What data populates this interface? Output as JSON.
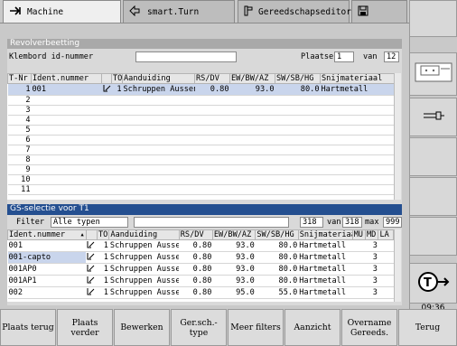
{
  "tabs": [
    {
      "label": "Machine",
      "icon": "machine-arrow-icon"
    },
    {
      "label": "smart.Turn",
      "icon": "smart-turn-arrows-icon"
    },
    {
      "label": "Gereedschapseditor",
      "icon": "tool-editor-icon"
    },
    {
      "label": "",
      "icon": "save-disk-icon"
    }
  ],
  "revolver": {
    "title": "Revolverbeetting",
    "clipboard_label": "Klembord id-nummer",
    "clipboard_value": "",
    "places_label": "Plaatsen",
    "place_current": "1",
    "place_of": "van",
    "place_total": "12",
    "columns": [
      "T-Nr",
      "Ident.nummer",
      "TO",
      "Aanduiding",
      "RS/DV",
      "EW/BW/AZ",
      "SW/SB/HG",
      "Snijmateriaal"
    ],
    "rows": [
      {
        "tnr": "1",
        "ident": "001",
        "to": "1",
        "name": "Schruppen Aussen",
        "rs": "0.80",
        "ew": "93.0",
        "sw": "80.0",
        "mat": "Hartmetall"
      },
      {
        "tnr": "2"
      },
      {
        "tnr": "3"
      },
      {
        "tnr": "4"
      },
      {
        "tnr": "5"
      },
      {
        "tnr": "6"
      },
      {
        "tnr": "7"
      },
      {
        "tnr": "8"
      },
      {
        "tnr": "9"
      },
      {
        "tnr": "10"
      },
      {
        "tnr": "11"
      }
    ]
  },
  "selection": {
    "title": "GS-selectie voor T1",
    "filter_label": "Filter",
    "filter_value": "Alle typen",
    "count": "318",
    "of": "van",
    "total": "318",
    "max_label": "max",
    "max_value": "999",
    "columns": [
      "Ident.nummer",
      "TO",
      "Aanduiding",
      "RS/DV",
      "EW/BW/AZ",
      "SW/SB/HG",
      "Snijmateriaal",
      "MU",
      "MD",
      "LA"
    ],
    "rows": [
      {
        "ident": "001",
        "to": "1",
        "name": "Schruppen Aussen",
        "rs": "0.80",
        "ew": "93.0",
        "sw": "80.0",
        "mat": "Hartmetall",
        "md": "3"
      },
      {
        "ident": "001-capto",
        "to": "1",
        "name": "Schruppen Aussen",
        "rs": "0.80",
        "ew": "93.0",
        "sw": "80.0",
        "mat": "Hartmetall",
        "md": "3"
      },
      {
        "ident": "001AP0",
        "to": "1",
        "name": "Schruppen Aussen",
        "rs": "0.80",
        "ew": "93.0",
        "sw": "80.0",
        "mat": "Hartmetall",
        "md": "3"
      },
      {
        "ident": "001AP1",
        "to": "1",
        "name": "Schruppen Aussen",
        "rs": "0.80",
        "ew": "93.0",
        "sw": "80.0",
        "mat": "Hartmetall",
        "md": "3"
      },
      {
        "ident": "002",
        "to": "1",
        "name": "Schruppen Aussen",
        "rs": "0.80",
        "ew": "95.0",
        "sw": "55.0",
        "mat": "Hartmetall",
        "md": "3"
      }
    ]
  },
  "softkeys": [
    "Plaats terug",
    "Plaats verder",
    "Bewerken",
    "Ger.sch.- type",
    "Meer filters",
    "Aanzicht",
    "Overname Gereeds.",
    "Terug"
  ],
  "clock": "09:36",
  "colors": {
    "title_blue": "#244f90",
    "selected_row": "#c9d5ec",
    "header_gray": "#a9a9a9"
  }
}
